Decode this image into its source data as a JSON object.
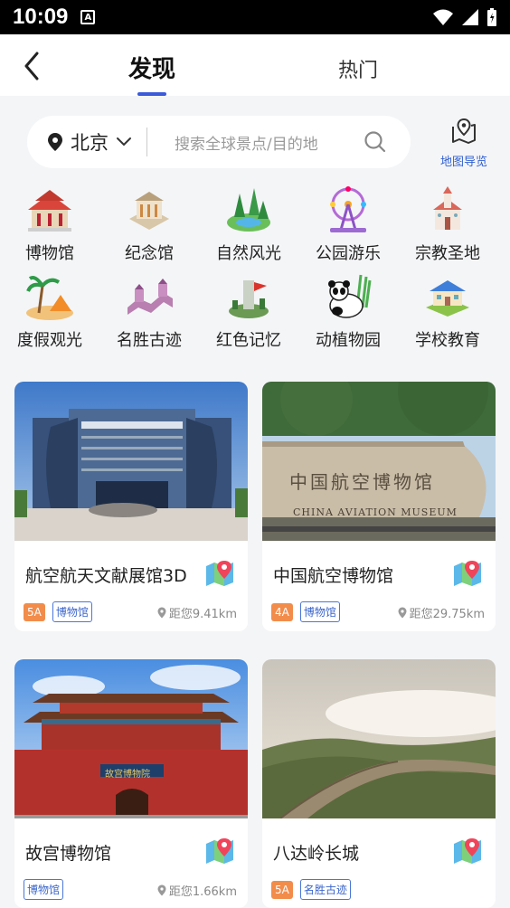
{
  "status": {
    "time": "10:09",
    "a_icon": "A"
  },
  "header": {
    "tab_discover": "发现",
    "tab_hot": "热门"
  },
  "search": {
    "city": "北京",
    "placeholder": "搜索全球景点/目的地",
    "map_guide": "地图导览"
  },
  "categories": [
    {
      "label": "博物馆",
      "icon": "museum-icon"
    },
    {
      "label": "纪念馆",
      "icon": "memorial-icon"
    },
    {
      "label": "自然风光",
      "icon": "nature-icon"
    },
    {
      "label": "公园游乐",
      "icon": "ferris-wheel-icon"
    },
    {
      "label": "宗教圣地",
      "icon": "church-icon"
    },
    {
      "label": "度假观光",
      "icon": "resort-icon"
    },
    {
      "label": "名胜古迹",
      "icon": "great-wall-icon"
    },
    {
      "label": "红色记忆",
      "icon": "red-memory-icon"
    },
    {
      "label": "动植物园",
      "icon": "panda-icon"
    },
    {
      "label": "学校教育",
      "icon": "school-icon"
    }
  ],
  "cards": [
    {
      "title": "航空航天文献展馆3D",
      "grade": "5A",
      "type": "博物馆",
      "distance": "距您9.41km",
      "photo_text": ""
    },
    {
      "title": "中国航空博物馆",
      "grade": "4A",
      "type": "博物馆",
      "distance": "距您29.75km",
      "photo_text": "中国航空博物馆",
      "photo_text_en": "CHINA AVIATION MUSEUM"
    },
    {
      "title": "故宫博物馆",
      "grade": "",
      "type": "博物馆",
      "distance": "距您1.66km",
      "photo_text": "故宫博物院"
    },
    {
      "title": "八达岭长城",
      "grade": "5A",
      "type": "名胜古迹",
      "distance": "",
      "photo_text": ""
    }
  ]
}
